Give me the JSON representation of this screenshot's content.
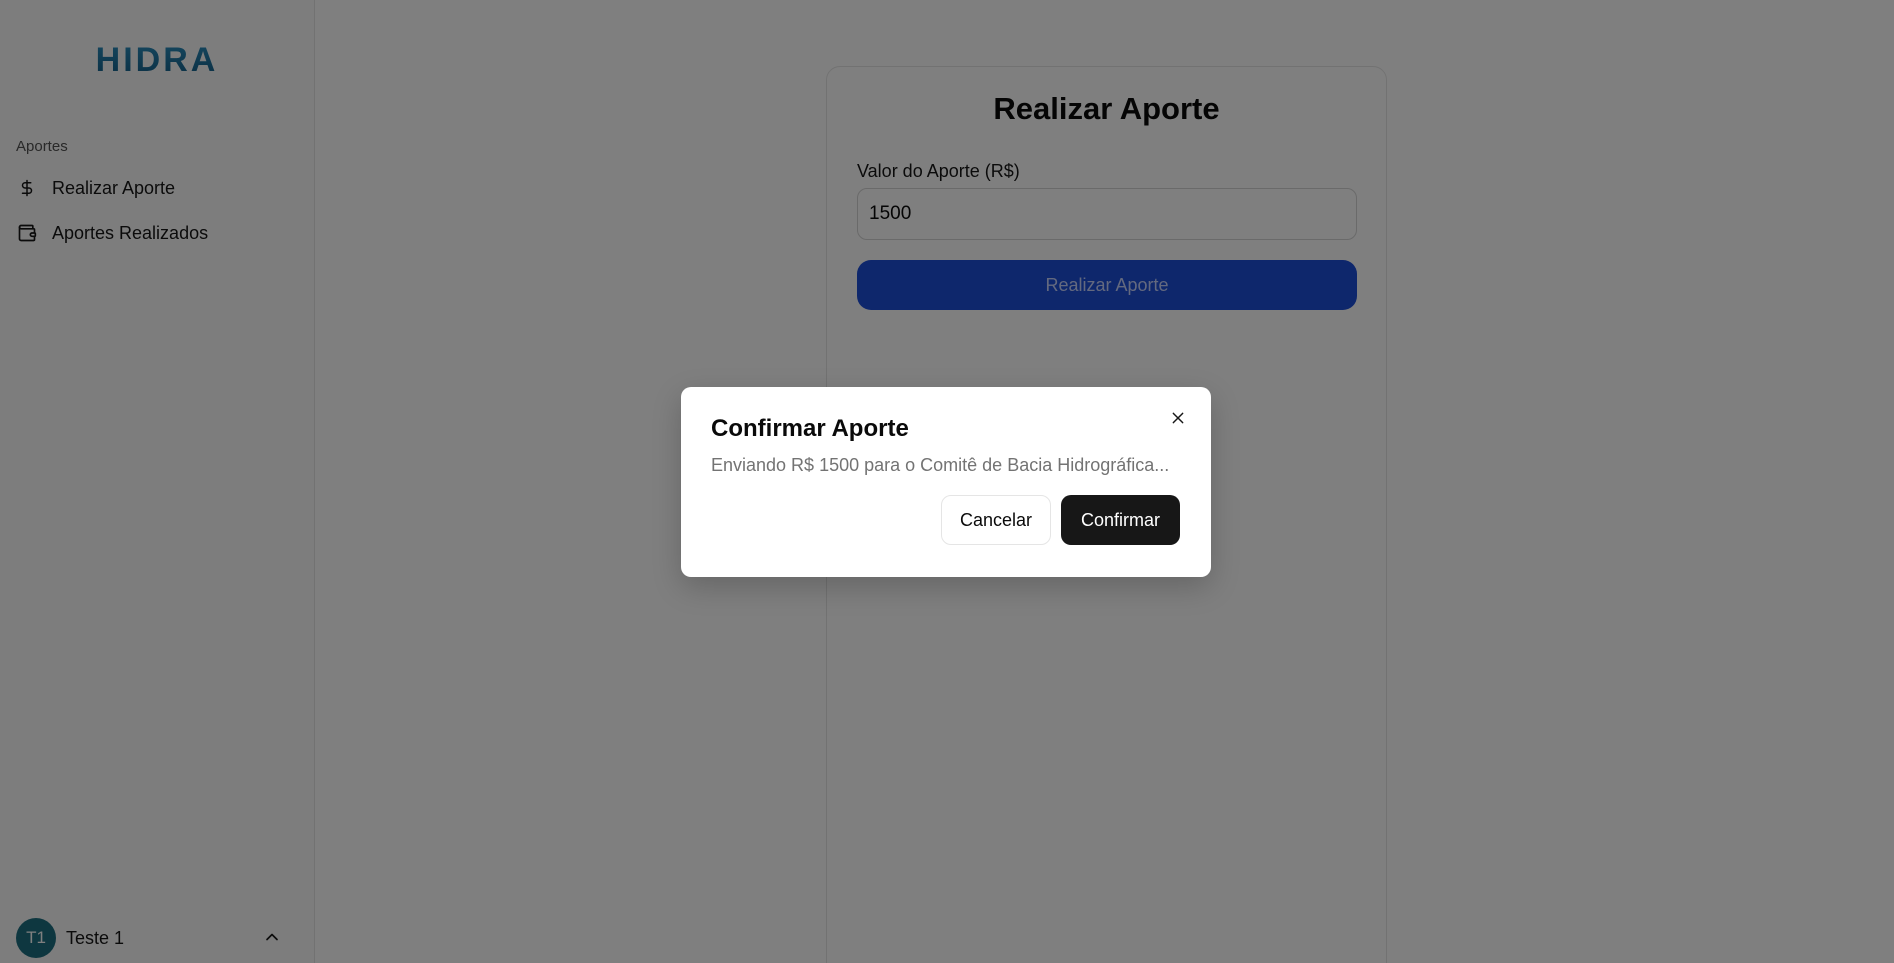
{
  "sidebar": {
    "logo_text": "HIDRA",
    "group_label": "Aportes",
    "items": [
      {
        "label": "Realizar Aporte",
        "icon": "dollar-sign-icon"
      },
      {
        "label": "Aportes Realizados",
        "icon": "wallet-icon"
      }
    ],
    "user": {
      "initials": "T1",
      "name": "Teste 1",
      "icon": "chevron-up-icon"
    }
  },
  "main": {
    "title": "Realizar Aporte",
    "amount_label": "Valor do Aporte (R$)",
    "amount_value": "1500",
    "submit_label": "Realizar Aporte"
  },
  "dialog": {
    "title": "Confirmar Aporte",
    "description": "Enviando R$ 1500 para o Comitê de Bacia Hidrográfica...",
    "cancel_label": "Cancelar",
    "confirm_label": "Confirmar",
    "close_icon": "close-icon"
  },
  "colors": {
    "brand": "#1e7fa8",
    "primary_button": "#1d4ed8",
    "confirm_button": "#171717",
    "avatar": "#1c6e80"
  }
}
